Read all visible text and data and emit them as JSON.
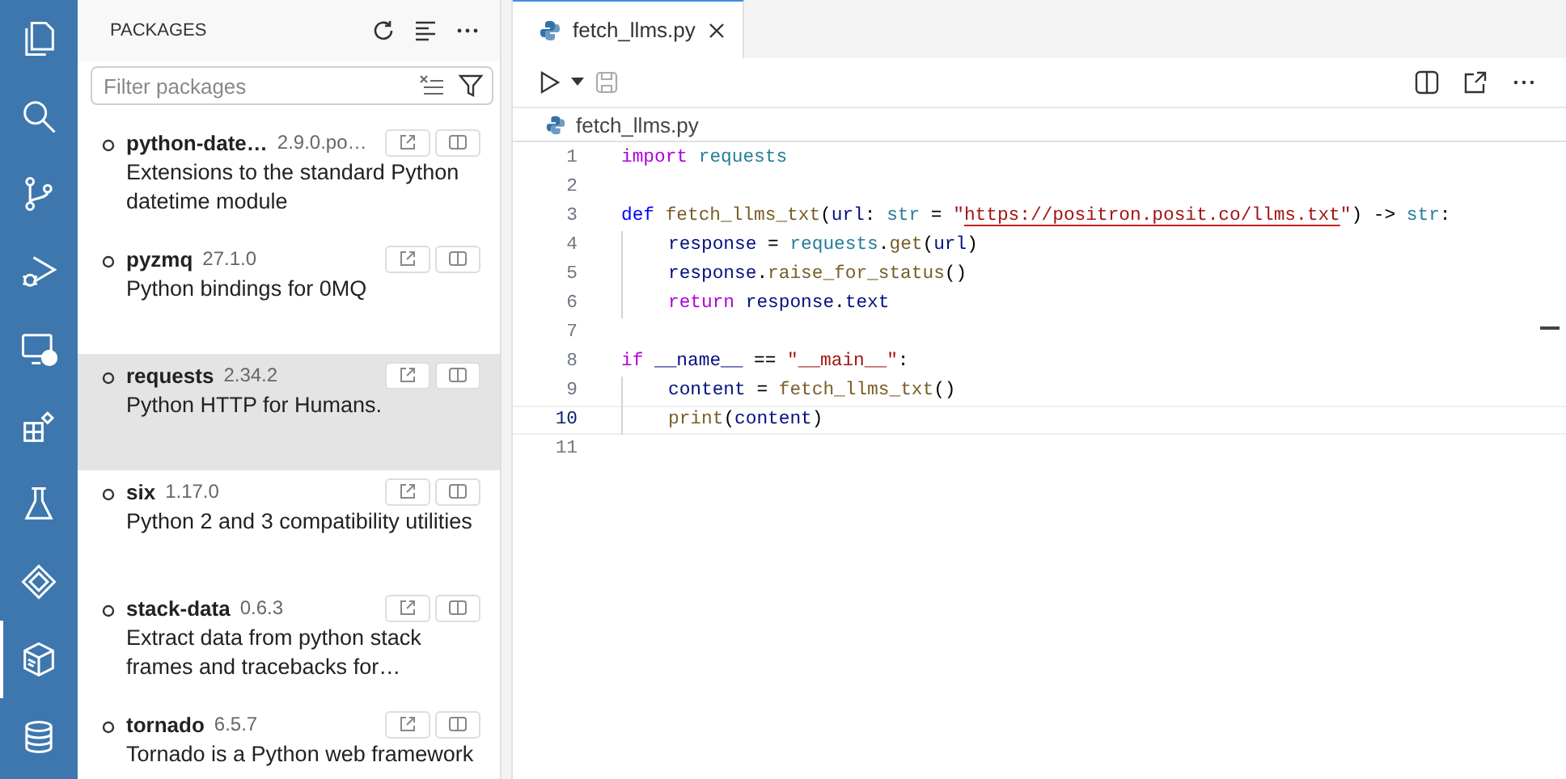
{
  "activity_bar": [
    {
      "kind": "files",
      "selected": false
    },
    {
      "kind": "search",
      "selected": false
    },
    {
      "kind": "git",
      "selected": false
    },
    {
      "kind": "debug",
      "selected": false
    },
    {
      "kind": "remote",
      "selected": false
    },
    {
      "kind": "extensions",
      "selected": false
    },
    {
      "kind": "flask",
      "selected": false
    },
    {
      "kind": "diamond",
      "selected": false
    },
    {
      "kind": "cube",
      "selected": true
    },
    {
      "kind": "database",
      "selected": false
    }
  ],
  "sidebar": {
    "title": "PACKAGES",
    "filter": {
      "placeholder": "Filter packages"
    },
    "packages": [
      {
        "name": "python-date…",
        "version": "2.9.0.po…",
        "description": "Extensions to the standard Python datetime module",
        "selected": false
      },
      {
        "name": "pyzmq",
        "version": "27.1.0",
        "description": "Python bindings for 0MQ",
        "selected": false
      },
      {
        "name": "requests",
        "version": "2.34.2",
        "description": "Python HTTP for Humans.",
        "selected": true
      },
      {
        "name": "six",
        "version": "1.17.0",
        "description": "Python 2 and 3 compatibility utilities",
        "selected": false
      },
      {
        "name": "stack-data",
        "version": "0.6.3",
        "description": "Extract data from python stack frames and tracebacks for…",
        "selected": false
      },
      {
        "name": "tornado",
        "version": "6.5.7",
        "description": "Tornado is a Python web framework",
        "selected": false
      }
    ]
  },
  "editor": {
    "tabs": [
      {
        "label": "fetch_llms.py",
        "selected": true
      }
    ],
    "breadcrumb": "fetch_llms.py",
    "lines": [
      {
        "number": "1",
        "indented": false,
        "current": false,
        "tokens": [
          {
            "t": "import ",
            "kind": "kw"
          },
          {
            "t": "requests",
            "kind": "mod"
          }
        ]
      },
      {
        "number": "2",
        "indented": false,
        "current": false
      },
      {
        "number": "3",
        "indented": false,
        "current": false,
        "tokens": [
          {
            "t": "def ",
            "kind": "def"
          },
          {
            "t": "fetch_llms_txt",
            "kind": "fn"
          },
          {
            "t": "(",
            "kind": "plain"
          },
          {
            "t": "url",
            "kind": "var"
          },
          {
            "t": ": ",
            "kind": "plain"
          },
          {
            "t": "str",
            "kind": "mod"
          },
          {
            "t": " = ",
            "kind": "plain"
          },
          {
            "t": "\"",
            "kind": "str"
          },
          {
            "t": "https://positron.posit.co/llms.txt",
            "kind": "link"
          },
          {
            "t": "\"",
            "kind": "str"
          },
          {
            "t": ") -> ",
            "kind": "plain"
          },
          {
            "t": "str",
            "kind": "mod"
          },
          {
            "t": ":",
            "kind": "plain"
          }
        ]
      },
      {
        "number": "4",
        "indented": true,
        "current": false,
        "tokens": [
          {
            "t": "response",
            "kind": "var"
          },
          {
            "t": " = ",
            "kind": "plain"
          },
          {
            "t": "requests",
            "kind": "mod"
          },
          {
            "t": ".",
            "kind": "plain"
          },
          {
            "t": "get",
            "kind": "fn"
          },
          {
            "t": "(",
            "kind": "plain"
          },
          {
            "t": "url",
            "kind": "var"
          },
          {
            "t": ")",
            "kind": "plain"
          }
        ]
      },
      {
        "number": "5",
        "indented": true,
        "current": false,
        "tokens": [
          {
            "t": "response",
            "kind": "var"
          },
          {
            "t": ".",
            "kind": "plain"
          },
          {
            "t": "raise_for_status",
            "kind": "fn"
          },
          {
            "t": "()",
            "kind": "plain"
          }
        ]
      },
      {
        "number": "6",
        "indented": true,
        "current": false,
        "tokens": [
          {
            "t": "return ",
            "kind": "kw"
          },
          {
            "t": "response",
            "kind": "var"
          },
          {
            "t": ".",
            "kind": "plain"
          },
          {
            "t": "text",
            "kind": "var"
          }
        ]
      },
      {
        "number": "7",
        "indented": false,
        "current": false
      },
      {
        "number": "8",
        "indented": false,
        "current": false,
        "tokens": [
          {
            "t": "if ",
            "kind": "kw"
          },
          {
            "t": "__name__",
            "kind": "var"
          },
          {
            "t": " == ",
            "kind": "plain"
          },
          {
            "t": "\"__main__\"",
            "kind": "str"
          },
          {
            "t": ":",
            "kind": "plain"
          }
        ]
      },
      {
        "number": "9",
        "indented": true,
        "current": false,
        "tokens": [
          {
            "t": "content",
            "kind": "var"
          },
          {
            "t": " = ",
            "kind": "plain"
          },
          {
            "t": "fetch_llms_txt",
            "kind": "fn"
          },
          {
            "t": "()",
            "kind": "plain"
          }
        ]
      },
      {
        "number": "10",
        "indented": true,
        "current": true,
        "tokens": [
          {
            "t": "print",
            "kind": "fn"
          },
          {
            "t": "(",
            "kind": "plain"
          },
          {
            "t": "content",
            "kind": "var"
          },
          {
            "t": ")",
            "kind": "plain"
          }
        ]
      },
      {
        "number": "11",
        "indented": false,
        "current": false
      }
    ]
  }
}
